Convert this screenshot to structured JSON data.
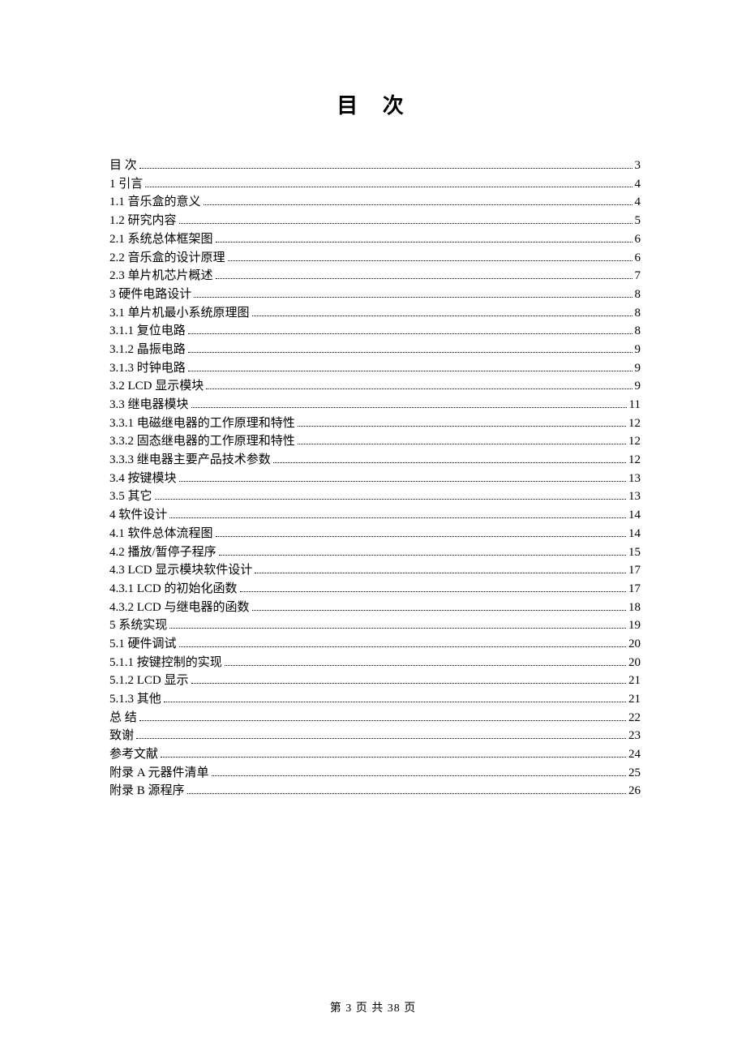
{
  "title": "目  次",
  "footer": "第 3 页 共 38 页",
  "toc": [
    {
      "label": "目   次",
      "page": "3"
    },
    {
      "label": "1 引言",
      "page": "4"
    },
    {
      "label": "1.1   音乐盒的意义",
      "page": "4"
    },
    {
      "label": "1.2   研究内容",
      "page": "5"
    },
    {
      "label": "2.1 系统总体框架图",
      "page": "6"
    },
    {
      "label": "2.2 音乐盒的设计原理",
      "page": "6"
    },
    {
      "label": "2.3 单片机芯片概述",
      "page": "7"
    },
    {
      "label": "3 硬件电路设计",
      "page": "8"
    },
    {
      "label": "3.1 单片机最小系统原理图",
      "page": "8"
    },
    {
      "label": "3.1.1 复位电路",
      "page": "8"
    },
    {
      "label": "3.1.2 晶振电路",
      "page": "9"
    },
    {
      "label": "3.1.3 时钟电路",
      "page": "9"
    },
    {
      "label": "3.2  LCD 显示模块",
      "page": "9"
    },
    {
      "label": "3.3  继电器模块",
      "page": "11"
    },
    {
      "label": "3.3.1 电磁继电器的工作原理和特性",
      "page": "12"
    },
    {
      "label": "3.3.2 固态继电器的工作原理和特性",
      "page": "12"
    },
    {
      "label": "3.3.3 继电器主要产品技术参数",
      "page": "12"
    },
    {
      "label": "3.4 按键模块",
      "page": "13"
    },
    {
      "label": "3.5  其它",
      "page": "13"
    },
    {
      "label": "4 软件设计",
      "page": "14"
    },
    {
      "label": "4.1 软件总体流程图",
      "page": "14"
    },
    {
      "label": "4.2 播放/暂停子程序",
      "page": "15"
    },
    {
      "label": "4.3 LCD 显示模块软件设计",
      "page": "17"
    },
    {
      "label": "4.3.1 LCD 的初始化函数",
      "page": "17"
    },
    {
      "label": "4.3.2 LCD 与继电器的函数",
      "page": "18"
    },
    {
      "label": "5 系统实现",
      "page": "19"
    },
    {
      "label": "5.1 硬件调试",
      "page": "20"
    },
    {
      "label": "5.1.1 按键控制的实现",
      "page": "20"
    },
    {
      "label": "5.1.2  LCD 显示",
      "page": "21"
    },
    {
      "label": "5.1.3 其他",
      "page": "21"
    },
    {
      "label": "总 结",
      "page": "22"
    },
    {
      "label": "致谢",
      "page": "23"
    },
    {
      "label": "参考文献",
      "page": "24"
    },
    {
      "label": "附录 A 元器件清单",
      "page": "25"
    },
    {
      "label": "附录 B 源程序",
      "page": "26"
    }
  ]
}
